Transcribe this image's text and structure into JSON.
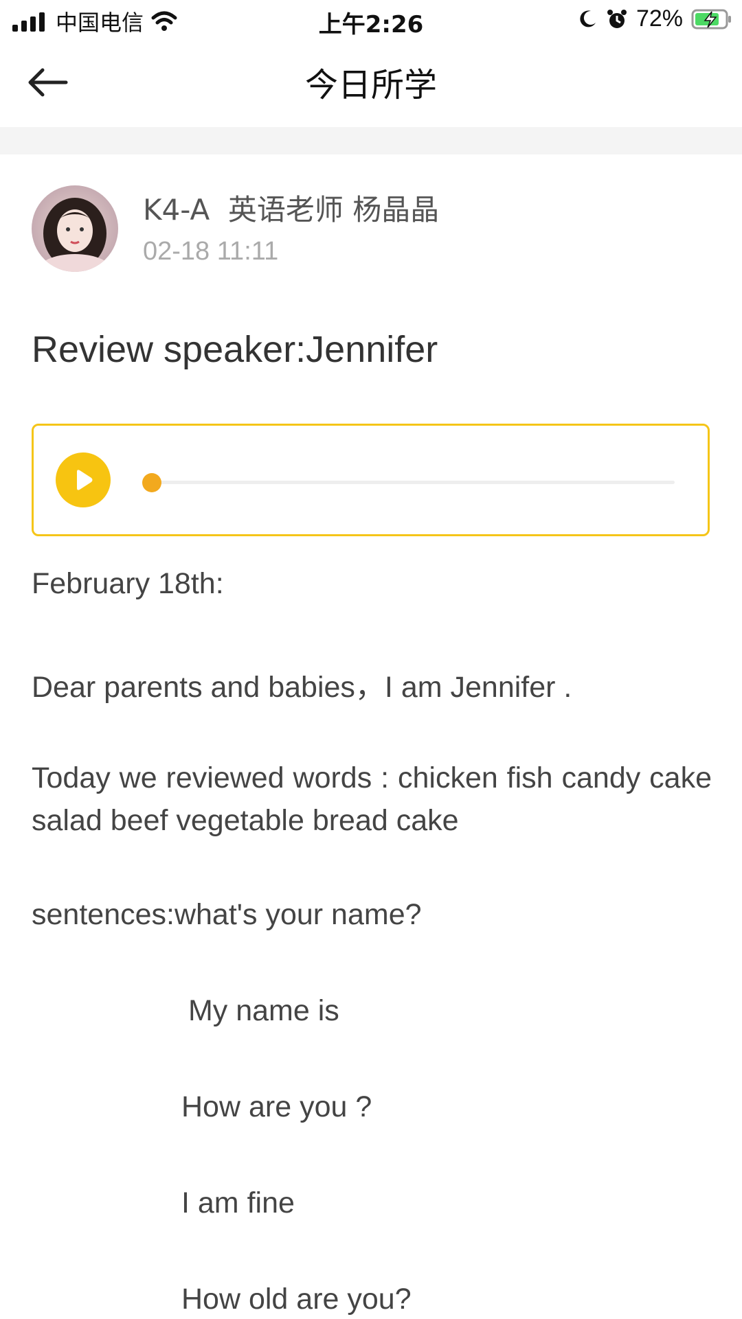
{
  "status_bar": {
    "carrier": "中国电信",
    "time": "上午2:26",
    "battery": "72%"
  },
  "nav": {
    "title": "今日所学",
    "back_icon": "arrow-left-icon"
  },
  "post": {
    "author": "K4-A  英语老师 杨晶晶",
    "time": "02-18 11:11",
    "title": "Review speaker:Jennifer"
  },
  "audio": {
    "play_icon": "play-icon",
    "progress": 0,
    "accent_color": "#f5c518",
    "knob_color": "#f2a91e"
  },
  "content": {
    "date_line": "February 18th:",
    "greeting": "Dear parents and babies，I am Jennifer .",
    "words": "Today we reviewed words : chicken fish candy cake  salad beef vegetable bread cake",
    "sentences_label": "sentences:what's your name?",
    "s1": " My name is",
    "s2": "How are you ?",
    "s3": "I am fine",
    "s4": "How old are you?"
  }
}
